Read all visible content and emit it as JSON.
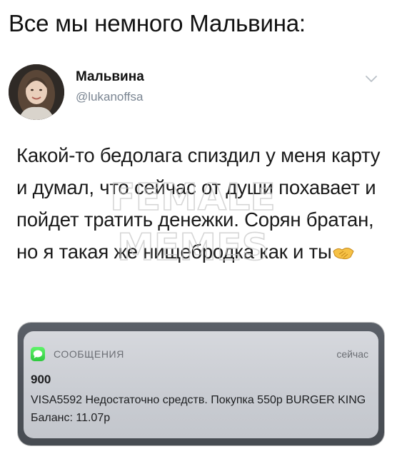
{
  "caption": "Все мы немного Мальвина:",
  "tweet": {
    "author_name": "Мальвина",
    "author_handle": "@lukanoffsa",
    "text": "Какой-то бедолага спиздил у меня карту и думал, что сейчас от души похавает и пойдет тратить денежки. Сорян братан, но я такая же нищебродка как и ты",
    "emoji": "handshake-icon"
  },
  "watermark": {
    "line1": "FEMALE",
    "line2": "MEMES"
  },
  "notification": {
    "app_name": "СООБЩЕНИЯ",
    "time": "сейчас",
    "sender": "900",
    "body": "VISA5592 Недостаточно средств. Покупка 550р BURGER KING Баланс: 11.07р",
    "accent_color": "#34c759"
  }
}
